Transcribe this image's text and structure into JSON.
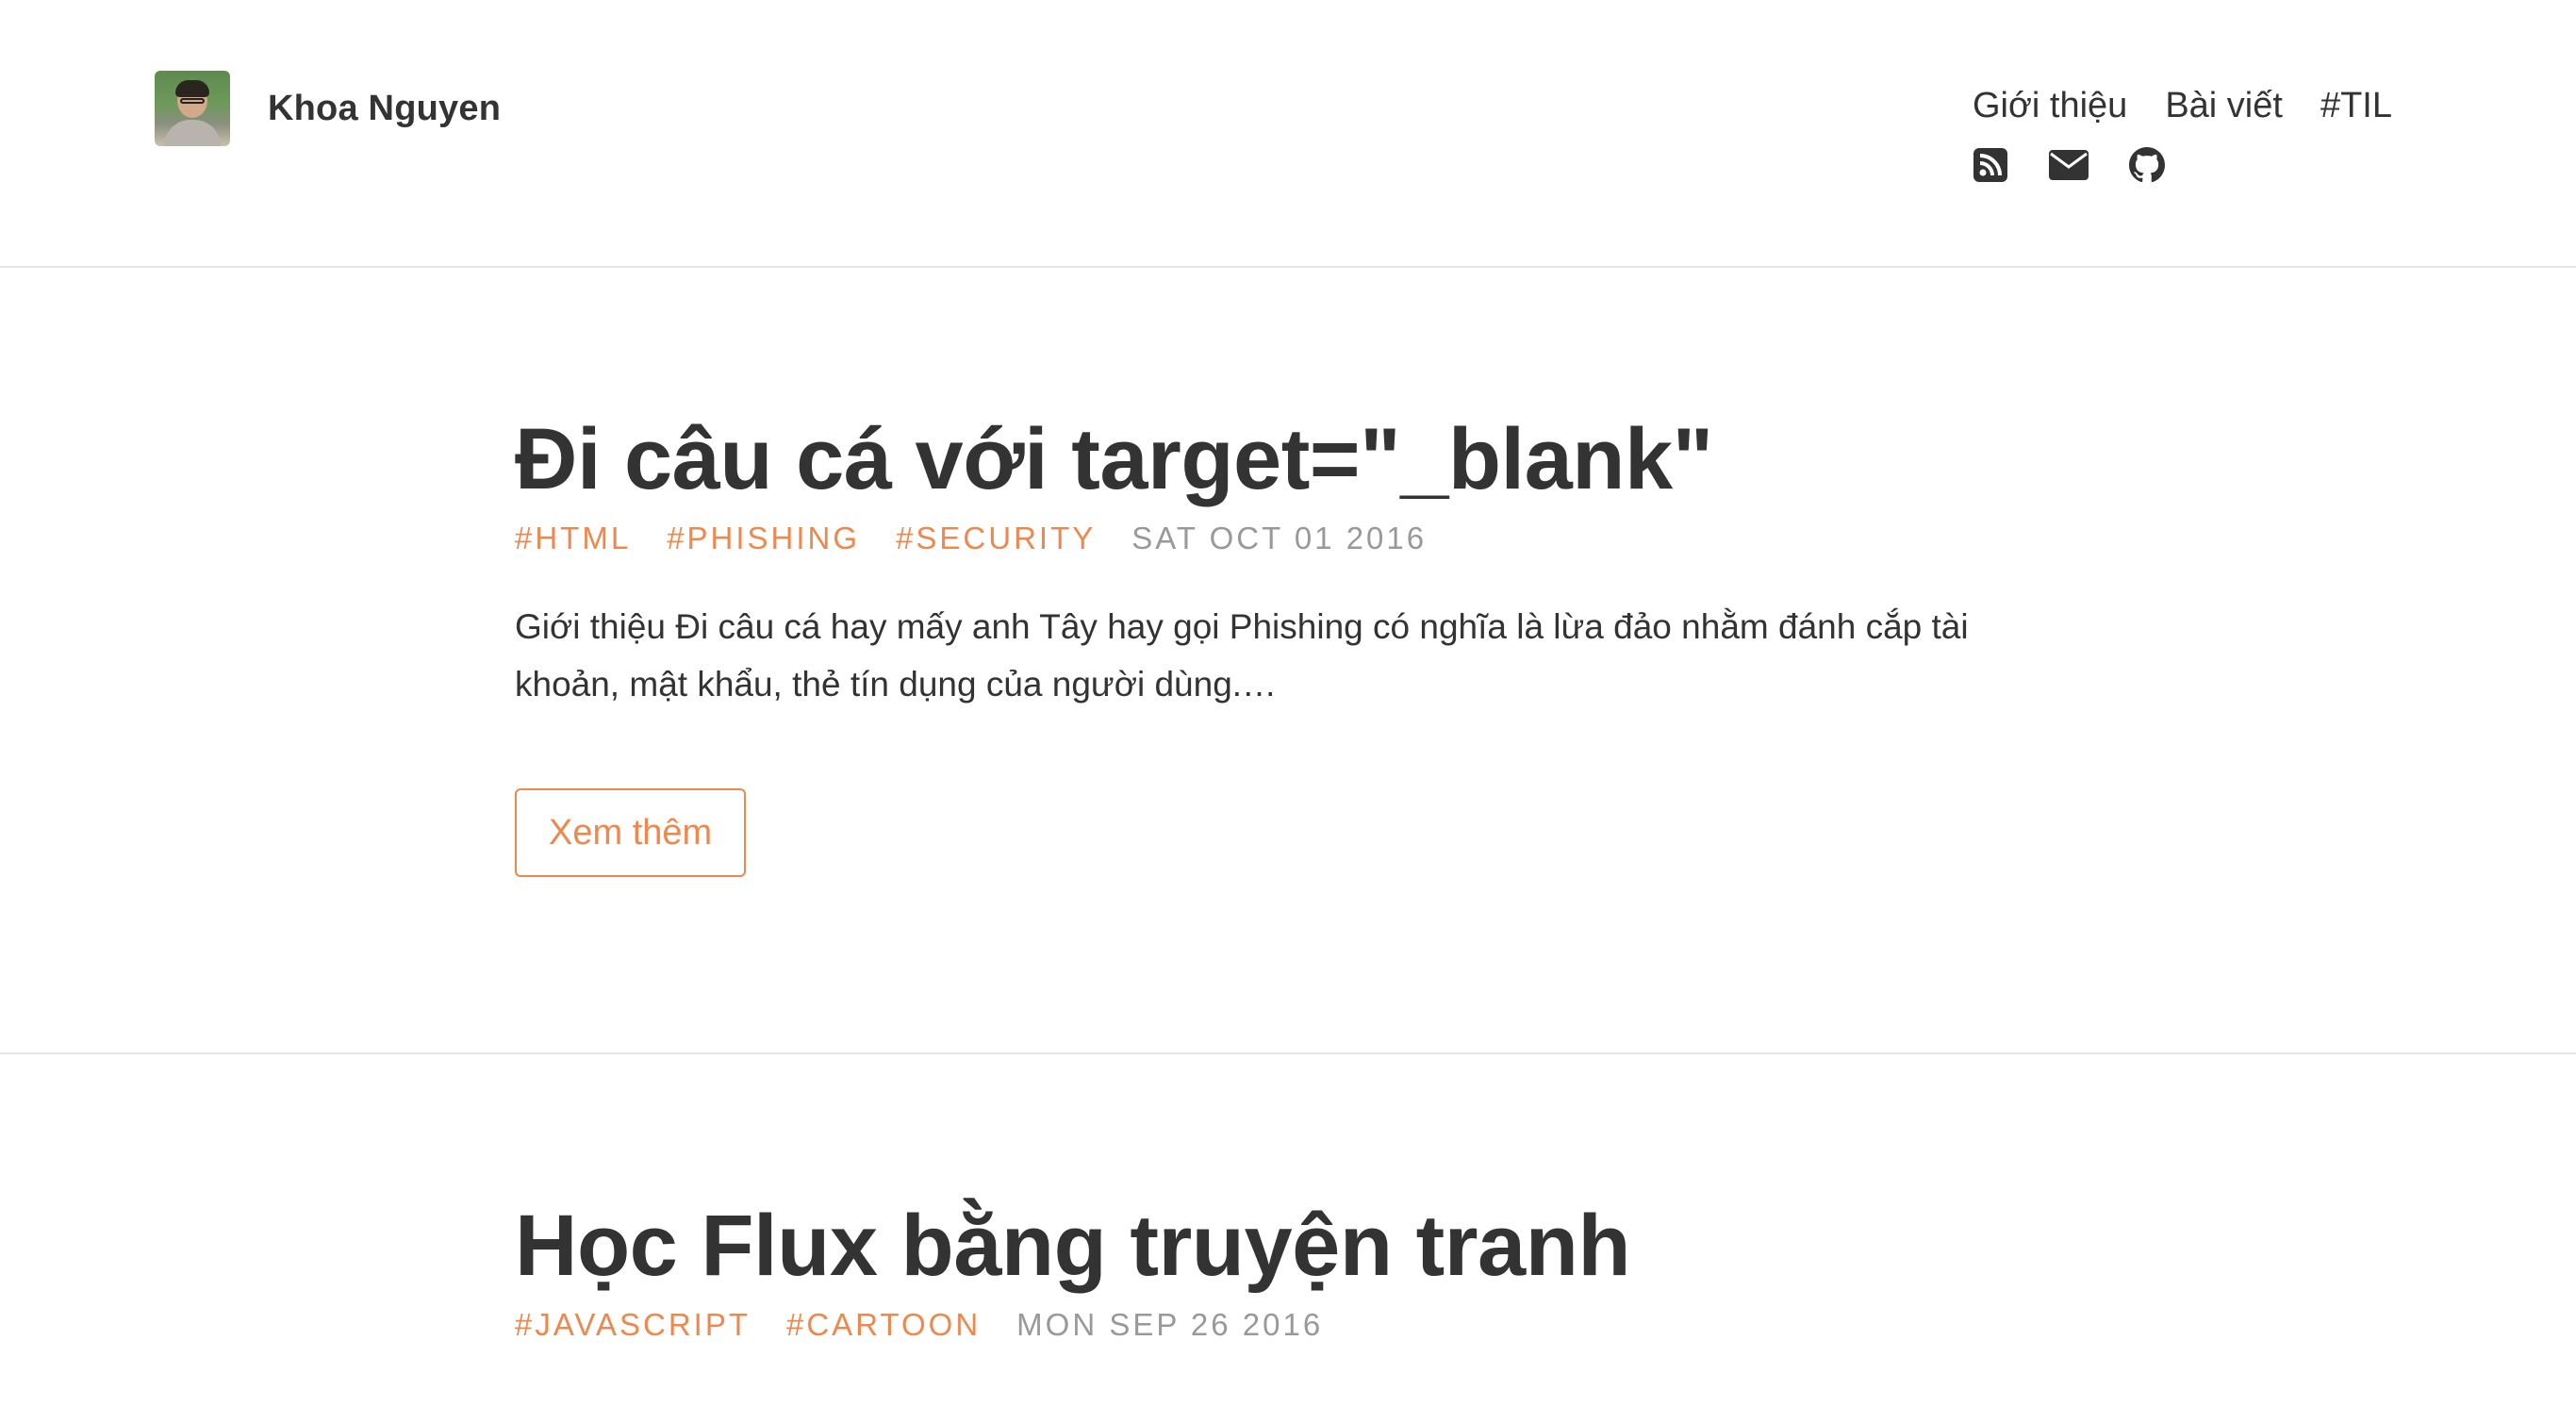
{
  "site": {
    "author_name": "Khoa Nguyen"
  },
  "nav": {
    "items": [
      {
        "label": "Giới thiệu"
      },
      {
        "label": "Bài viết"
      },
      {
        "label": "#TIL"
      }
    ],
    "social": [
      {
        "icon": "rss-icon"
      },
      {
        "icon": "envelope-icon"
      },
      {
        "icon": "github-icon"
      }
    ]
  },
  "posts": [
    {
      "title": "Đi câu cá với target=\"_blank\"",
      "tags": [
        "#HTML",
        "#PHISHING",
        "#SECURITY"
      ],
      "date": "SAT OCT 01 2016",
      "excerpt": "Giới thiệu Đi câu cá hay mấy anh Tây hay gọi Phishing có nghĩa là lừa đảo nhằm đánh cắp tài khoản, mật khẩu, thẻ tín dụng của người dùng.…",
      "more_label": "Xem thêm"
    },
    {
      "title": "Học Flux bằng truyện tranh",
      "tags": [
        "#JAVASCRIPT",
        "#CARTOON"
      ],
      "date": "MON SEP 26 2016"
    }
  ],
  "colors": {
    "accent": "#f0874d",
    "text": "#333333",
    "muted": "#999999",
    "divider": "#e6e6e6"
  }
}
